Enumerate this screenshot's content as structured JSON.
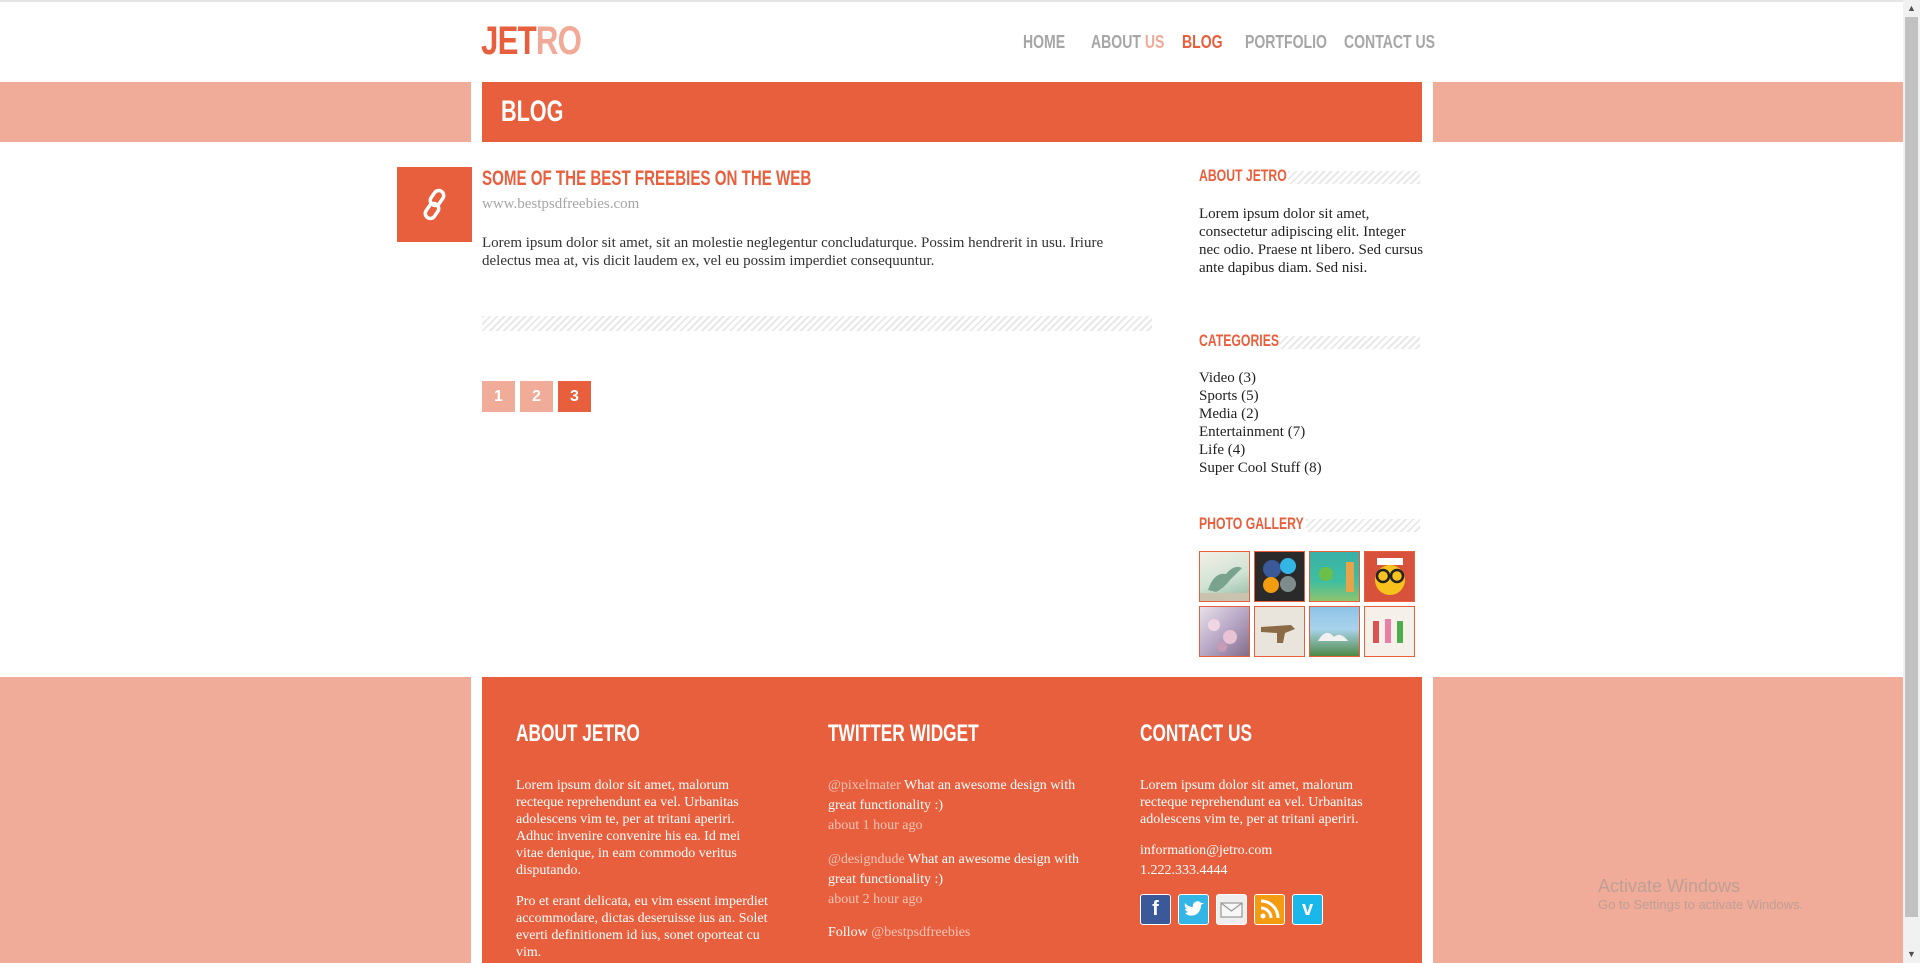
{
  "colors": {
    "accent": "#e85f3d",
    "accent_light": "#f0ac98",
    "muted": "#a6a6a6"
  },
  "header": {
    "logo_part1": "JET",
    "logo_part2": "RO",
    "nav": [
      {
        "label": "HOME"
      },
      {
        "label": "ABOUT",
        "label_accent": "US"
      },
      {
        "label": "BLOG",
        "active": true
      },
      {
        "label": "PORTFOLIO"
      },
      {
        "label": "CONTACT US"
      }
    ]
  },
  "banner": {
    "title": "BLOG"
  },
  "post": {
    "icon": "link-icon",
    "title": "SOME OF THE BEST FREEBIES ON THE WEB",
    "link": "www.bestpsdfreebies.com",
    "body": "Lorem ipsum dolor sit amet, sit an molestie neglegentur concludaturque. Possim hendrerit in usu. Iriure delectus mea at, vis dicit laudem ex, vel eu possim imperdiet consequuntur."
  },
  "pagination": {
    "pages": [
      "1",
      "2",
      "3"
    ],
    "current": 3
  },
  "sidebar": {
    "about": {
      "title": "ABOUT JETRO",
      "text": "Lorem ipsum dolor sit amet, consectetur adipiscing elit. Integer nec odio. Praese nt libero. Sed cursus ante dapibus diam. Sed nisi."
    },
    "categories": {
      "title": "CATEGORIES",
      "items": [
        {
          "name": "Video",
          "count": "(3)"
        },
        {
          "name": "Sports",
          "count": "(5)"
        },
        {
          "name": "Media",
          "count": "(2)"
        },
        {
          "name": "Entertainment",
          "count": "(7)"
        },
        {
          "name": "Life",
          "count": "(4)"
        },
        {
          "name": "Super Cool Stuff",
          "count": "(8)"
        }
      ]
    },
    "gallery": {
      "title": "PHOTO GALLERY",
      "thumbs": [
        "dinosaur-thumb",
        "social-icons-thumb",
        "cartoon-thumb",
        "glasses-character-thumb",
        "flowers-thumb",
        "gun-thumb",
        "landscape-thumb",
        "figures-thumb"
      ]
    }
  },
  "footer": {
    "about": {
      "title": "ABOUT JETRO",
      "p1": "Lorem ipsum dolor sit amet, malorum recteque reprehendunt ea vel. Urbanitas adolescens vim te, per at tritani aperiri. Adhuc invenire convenire his ea. Id mei vitae denique, in eam commodo veritus disputando.",
      "p2": "Pro et erant delicata, eu vim essent imperdiet accommodare, dictas deseruisse ius an. Solet everti definitionem id ius, sonet oporteat cu vim."
    },
    "twitter": {
      "title": "TWITTER WIDGET",
      "tweets": [
        {
          "user": "@pixelmater",
          "text": "What an awesome design with great functionality :)",
          "time": "about 1 hour ago"
        },
        {
          "user": "@designdude",
          "text": "What an awesome design with great functionality :)",
          "time": "about 2 hour ago"
        }
      ],
      "follow_label": "Follow",
      "follow_user": "@bestpsdfreebies"
    },
    "contact": {
      "title": "CONTACT US",
      "text": "Lorem ipsum dolor sit amet, malorum recteque reprehendunt ea vel. Urbanitas adolescens vim te, per at tritani aperiri.",
      "email": "information@jetro.com",
      "phone": "1.222.333.4444",
      "social": [
        "facebook-icon",
        "twitter-icon",
        "email-icon",
        "rss-icon",
        "vimeo-icon"
      ]
    }
  },
  "watermark": {
    "line1": "Activate Windows",
    "line2": "Go to Settings to activate Windows."
  }
}
